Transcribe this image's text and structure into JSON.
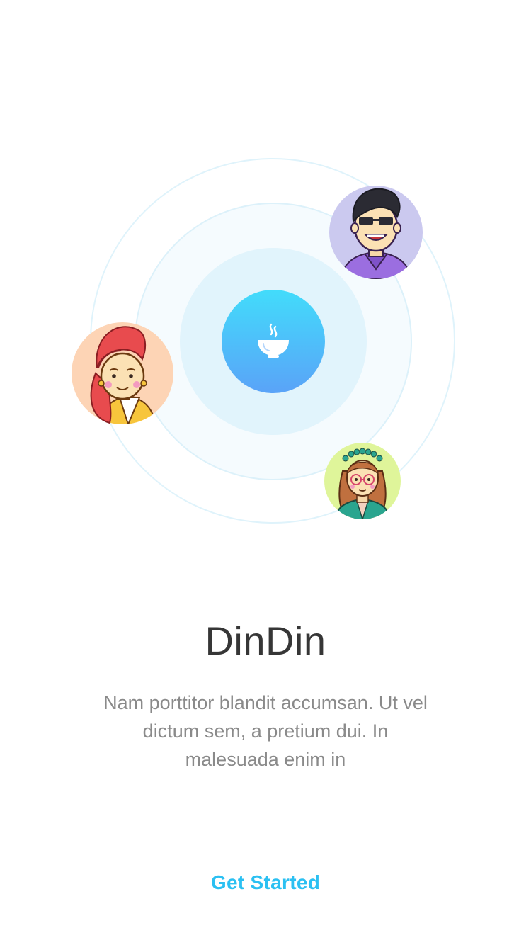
{
  "app": {
    "title": "DinDin",
    "description": "Nam porttitor blandit accumsan. Ut vel dictum sem, a pretium dui. In malesuada enim in",
    "cta_label": "Get Started"
  },
  "illustration": {
    "center_icon": "steaming-bowl-icon",
    "avatars": [
      "man-avatar",
      "woman-avatar",
      "girl-avatar"
    ]
  },
  "colors": {
    "accent": "#2bc0f2",
    "center_gradient_top": "#42dcfb",
    "center_gradient_bottom": "#5aa3f8",
    "title": "#363636",
    "body_text": "#8a8a8a"
  }
}
